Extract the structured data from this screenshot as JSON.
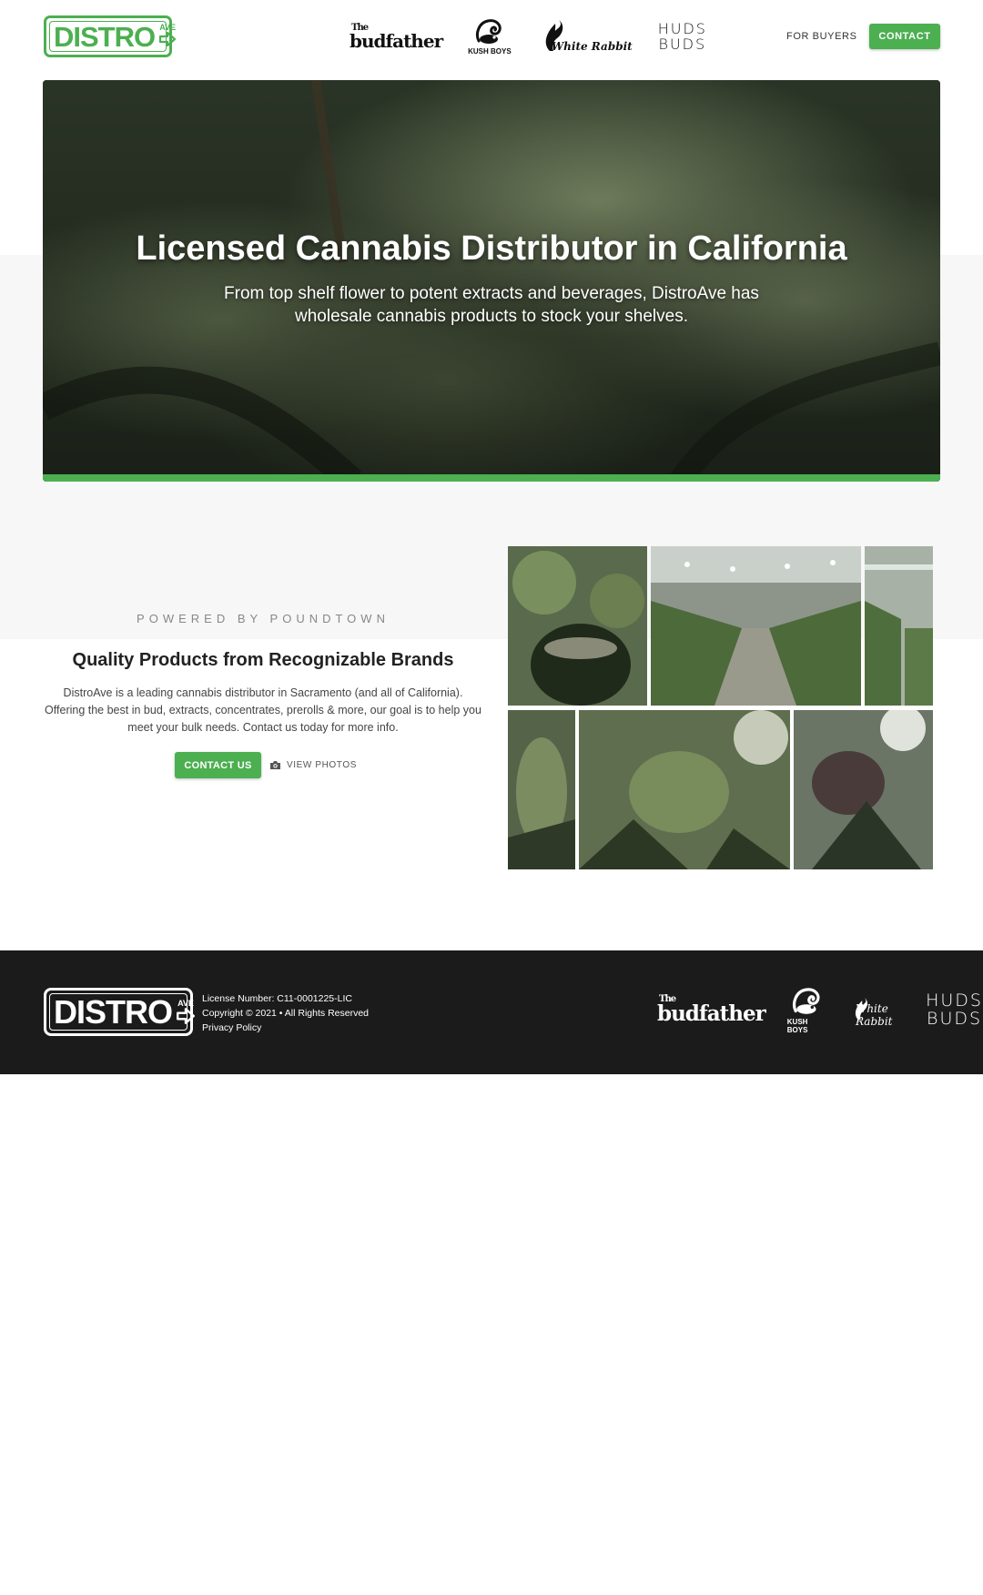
{
  "header": {
    "logo": {
      "word": "DISTRO",
      "badge": "AVE"
    },
    "brands": [
      {
        "the": "The",
        "name": "budfather"
      },
      {
        "name": "KUSH BOYS"
      },
      {
        "name": "White Rabbit"
      },
      {
        "line1": "HUDS",
        "line2": "BUDS"
      }
    ],
    "nav_buyers": "FOR BUYERS",
    "nav_contact": "CONTACT"
  },
  "hero": {
    "title": "Licensed Cannabis Distributor in California",
    "subtitle": "From top shelf flower to potent extracts and beverages, DistroAve has wholesale cannabis products to stock your shelves."
  },
  "intro": {
    "powered_by": "POWERED BY POUNDTOWN",
    "heading": "Quality Products from Recognizable Brands",
    "description": "DistroAve is a leading cannabis distributor in Sacramento (and all of California). Offering the best in bud, extracts, concentrates, prerolls & more, our goal is to help you meet your bulk needs. Contact us today for more info.",
    "contact_button": "CONTACT US",
    "photos_button": "VIEW PHOTOS"
  },
  "footer": {
    "license": "License Number: C11-0001225-LIC",
    "copyright": "Copyright © 2021 • All Rights Reserved",
    "privacy": "Privacy Policy"
  },
  "colors": {
    "accent": "#4caf50",
    "footer_bg": "#1b1b1b",
    "band_bg": "#f7f7f7"
  },
  "icons": [
    "arrow-right-icon",
    "camera-icon",
    "kush-boys-skunk-icon",
    "white-rabbit-icon"
  ]
}
